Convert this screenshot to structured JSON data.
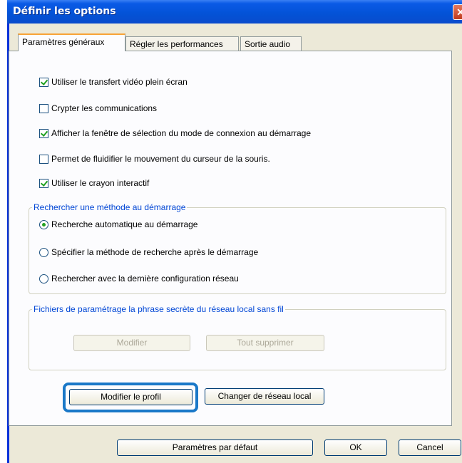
{
  "window": {
    "title": "Définir les options",
    "close_symbol": "✕"
  },
  "tabs": [
    {
      "label": "Paramètres généraux",
      "active": true
    },
    {
      "label": "Régler les performances",
      "active": false
    },
    {
      "label": "Sortie audio",
      "active": false
    }
  ],
  "checkboxes": [
    {
      "label": "Utiliser le transfert vidéo plein écran",
      "checked": true
    },
    {
      "label": "Crypter les communications",
      "checked": false
    },
    {
      "label": "Afficher la fenêtre de sélection du mode de connexion au démarrage",
      "checked": true
    },
    {
      "label": "Permet de fluidifier le mouvement du curseur de la souris.",
      "checked": false
    },
    {
      "label": "Utiliser le crayon interactif",
      "checked": true
    }
  ],
  "search_group": {
    "legend": "Rechercher une méthode au démarrage",
    "options": [
      {
        "label": "Recherche automatique au démarrage",
        "selected": true
      },
      {
        "label": "Spécifier la méthode de recherche après le démarrage",
        "selected": false
      },
      {
        "label": "Rechercher avec la dernière configuration réseau",
        "selected": false
      }
    ]
  },
  "passphrase_group": {
    "legend": "Fichiers de paramétrage la phrase secrète du réseau local sans fil",
    "modify_label": "Modifier",
    "delete_all_label": "Tout supprimer"
  },
  "profile_buttons": {
    "modify_profile": "Modifier le profil",
    "change_network": "Changer de réseau local"
  },
  "footer": {
    "defaults": "Paramètres par défaut",
    "ok": "OK",
    "cancel": "Cancel"
  },
  "colors": {
    "title_bar": "#0352d6",
    "highlight": "#1a78c8",
    "group_legend": "#0046d5"
  }
}
